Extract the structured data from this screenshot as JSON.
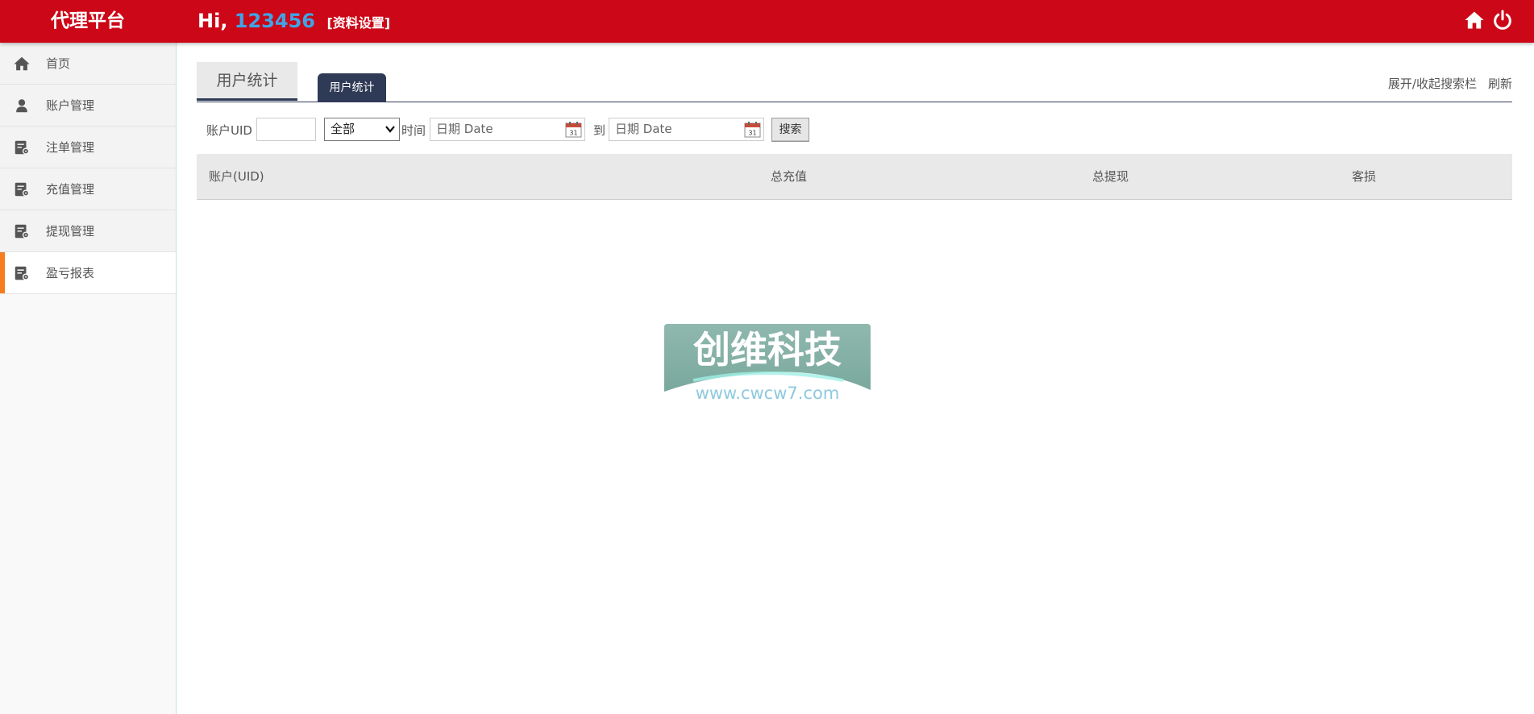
{
  "header": {
    "logo": "代理平台",
    "greeting": "Hi, ",
    "user_id": "123456",
    "settings_link": "[资料设置]",
    "home_icon": "home-icon",
    "power_icon": "power-icon",
    "bg_color": "#cc0717",
    "uid_color": "#3fa4e6"
  },
  "sidebar": {
    "items": [
      {
        "label": "首页",
        "icon": "home-icon"
      },
      {
        "label": "账户管理",
        "icon": "user-icon"
      },
      {
        "label": "注单管理",
        "icon": "document-gear-icon"
      },
      {
        "label": "充值管理",
        "icon": "document-gear-icon"
      },
      {
        "label": "提现管理",
        "icon": "document-gear-icon"
      },
      {
        "label": "盈亏报表",
        "icon": "document-gear-icon",
        "active": true
      }
    ],
    "active_color": "#f57c1f"
  },
  "tabs": {
    "page_title": "用户统计",
    "active_tab": "用户统计",
    "toggle_search": "展开/收起搜索栏",
    "refresh": "刷新"
  },
  "search": {
    "uid_label": "账户UID",
    "uid_value": "",
    "scope_selected": "全部",
    "time_label": "时间",
    "date_from_placeholder": "日期 Date",
    "to_label": "到",
    "date_to_placeholder": "日期 Date",
    "search_button": "搜索"
  },
  "table": {
    "columns": [
      "账户(UID)",
      "总充值",
      "总提现",
      "客损"
    ],
    "rows": []
  },
  "watermark": {
    "title": "创维科技",
    "url": "www.cwcw7.com"
  }
}
